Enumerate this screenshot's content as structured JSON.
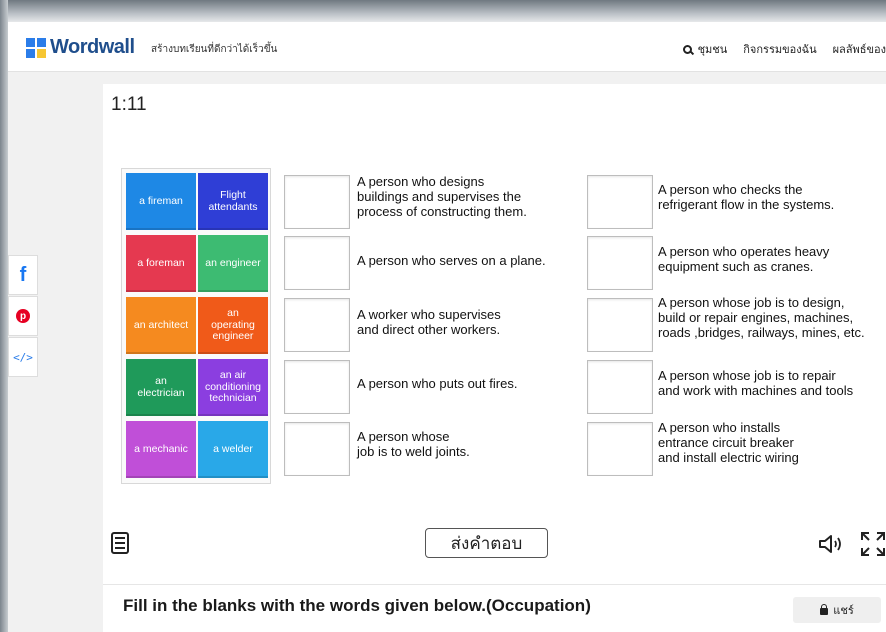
{
  "header": {
    "logo_text": "Wordwall",
    "tagline": "สร้างบทเรียนที่ดีกว่าได้เร็วขึ้น",
    "nav": [
      "ชุมชน",
      "กิจกรรมของฉัน",
      "ผลลัพธ์ของ"
    ]
  },
  "activity": {
    "timer": "1:11",
    "tiles": [
      {
        "label": "a fireman",
        "color": "#1e88e5"
      },
      {
        "label": "Flight\nattendants",
        "color": "#2f3ed6"
      },
      {
        "label": "a foreman",
        "color": "#e53950"
      },
      {
        "label": "an engineer",
        "color": "#3dbb72"
      },
      {
        "label": "an architect",
        "color": "#f58a1f"
      },
      {
        "label": "an\noperating\nengineer",
        "color": "#f05a19"
      },
      {
        "label": "an\nelectrician",
        "color": "#1f9a5a"
      },
      {
        "label": "an air\nconditioning\ntechnician",
        "color": "#8b3ee0"
      },
      {
        "label": "a mechanic",
        "color": "#c04fd8"
      },
      {
        "label": "a welder",
        "color": "#29a8e8"
      }
    ],
    "clues_left": [
      "A person who designs\nbuildings and supervises the\nprocess of constructing them.",
      "A person who serves on a plane.",
      "A worker who supervises\nand direct other workers.",
      "A person who puts out fires.",
      "A person whose\njob is to weld joints."
    ],
    "clues_right": [
      "A person who checks the\nrefrigerant flow in the systems.",
      "A person who operates heavy\nequipment such as cranes.",
      "A person whose job is to design,\nbuild or repair engines, machines,\nroads ,bridges, railways, mines, etc.",
      "A person whose job is to repair\nand work with machines and tools",
      "A person who installs\nentrance circuit breaker\nand install electric wiring"
    ],
    "submit_label": "ส่งคำตอบ"
  },
  "footer": {
    "title": "Fill in the blanks with the words given below.(Occupation)",
    "share_label": "แชร์"
  }
}
